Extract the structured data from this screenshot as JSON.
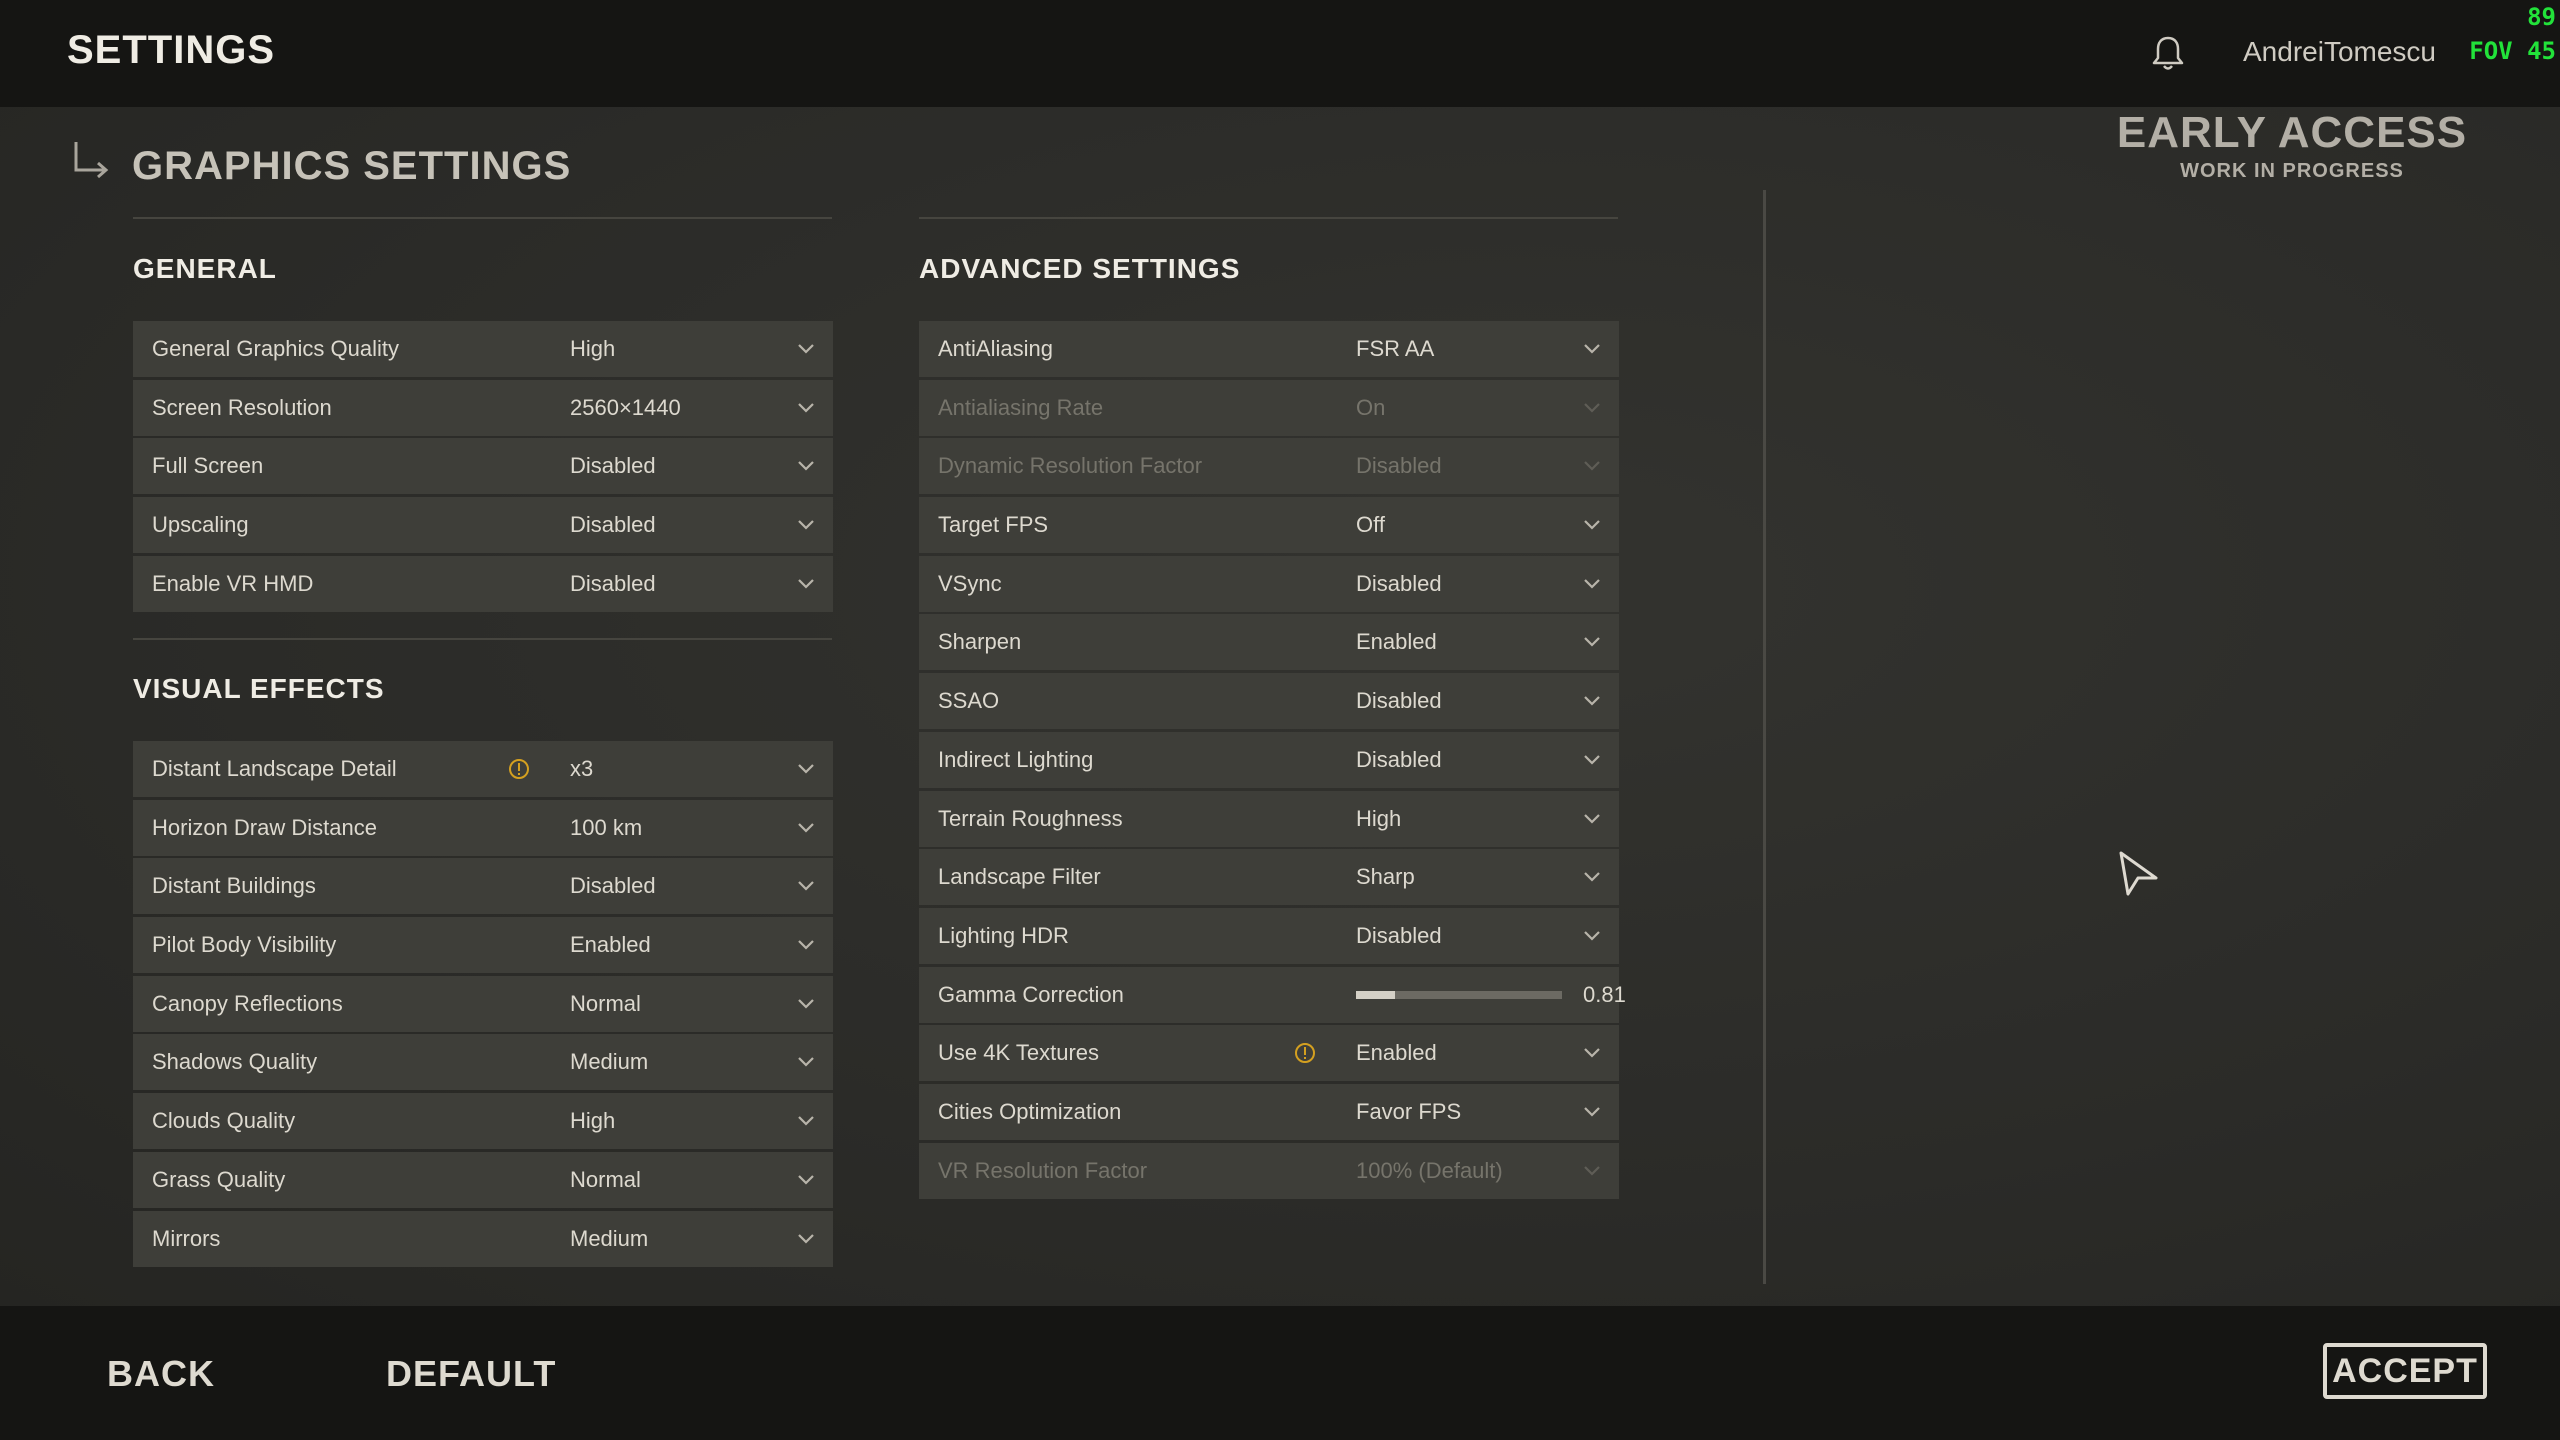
{
  "header": {
    "title": "SETTINGS",
    "username": "AndreiTomescu"
  },
  "overlay": {
    "fps": "89",
    "fov_label": "FOV",
    "fov": "45"
  },
  "badge": {
    "title": "EARLY ACCESS",
    "subtitle": "WORK IN PROGRESS"
  },
  "page": {
    "heading": "GRAPHICS SETTINGS"
  },
  "general": {
    "title": "GENERAL",
    "rows": [
      {
        "label": "General Graphics Quality",
        "value": "High"
      },
      {
        "label": "Screen Resolution",
        "value": "2560×1440"
      },
      {
        "label": "Full Screen",
        "value": "Disabled"
      },
      {
        "label": "Upscaling",
        "value": "Disabled"
      },
      {
        "label": "Enable VR HMD",
        "value": "Disabled"
      }
    ]
  },
  "visual": {
    "title": "VISUAL EFFECTS",
    "rows": [
      {
        "label": "Distant Landscape Detail",
        "value": "x3",
        "warning": true
      },
      {
        "label": "Horizon Draw Distance",
        "value": "100 km"
      },
      {
        "label": "Distant Buildings",
        "value": "Disabled"
      },
      {
        "label": "Pilot Body Visibility",
        "value": "Enabled"
      },
      {
        "label": "Canopy Reflections",
        "value": "Normal"
      },
      {
        "label": "Shadows Quality",
        "value": "Medium"
      },
      {
        "label": "Clouds Quality",
        "value": "High"
      },
      {
        "label": "Grass Quality",
        "value": "Normal"
      },
      {
        "label": "Mirrors",
        "value": "Medium"
      }
    ]
  },
  "advanced": {
    "title": "ADVANCED SETTINGS",
    "rows": [
      {
        "label": "AntiAliasing",
        "value": "FSR AA"
      },
      {
        "label": "Antialiasing Rate",
        "value": "On",
        "disabled": true
      },
      {
        "label": "Dynamic Resolution Factor",
        "value": "Disabled",
        "disabled": true
      },
      {
        "label": "Target FPS",
        "value": "Off"
      },
      {
        "label": "VSync",
        "value": "Disabled"
      },
      {
        "label": "Sharpen",
        "value": "Enabled"
      },
      {
        "label": "SSAO",
        "value": "Disabled"
      },
      {
        "label": "Indirect Lighting",
        "value": "Disabled"
      },
      {
        "label": "Terrain Roughness",
        "value": "High"
      },
      {
        "label": "Landscape Filter",
        "value": "Sharp"
      },
      {
        "label": "Lighting HDR",
        "value": "Disabled"
      },
      {
        "label": "Gamma Correction",
        "value": "0.81",
        "slider": true,
        "slider_fraction": 0.19
      },
      {
        "label": "Use 4K Textures",
        "value": "Enabled",
        "warning": true
      },
      {
        "label": "Cities Optimization",
        "value": "Favor FPS"
      },
      {
        "label": "VR Resolution Factor",
        "value": "100% (Default)",
        "disabled": true
      }
    ]
  },
  "footer": {
    "back": "BACK",
    "default": "DEFAULT",
    "accept": "ACCEPT"
  },
  "colors": {
    "warning": "#d4a020",
    "overlay_green": "#22e23a"
  }
}
